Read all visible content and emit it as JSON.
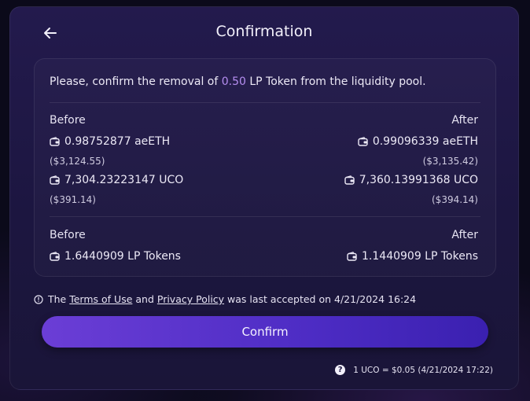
{
  "header": {
    "title": "Confirmation"
  },
  "message": {
    "prefix": "Please, confirm the removal of ",
    "amount": "0.50",
    "suffix": " LP Token from the liquidity pool."
  },
  "section1": {
    "before_label": "Before",
    "after_label": "After",
    "before": {
      "token1": "0.98752877 aeETH",
      "token1_usd": "($3,124.55)",
      "token2": "7,304.23223147 UCO",
      "token2_usd": "($391.14)"
    },
    "after": {
      "token1": "0.99096339 aeETH",
      "token1_usd": "($3,135.42)",
      "token2": "7,360.13991368 UCO",
      "token2_usd": "($394.14)"
    }
  },
  "section2": {
    "before_label": "Before",
    "after_label": "After",
    "before_value": "1.6440909 LP Tokens",
    "after_value": "1.1440909 LP Tokens"
  },
  "terms": {
    "prefix": "The ",
    "terms_link": "Terms of Use",
    "and": " and ",
    "privacy_link": "Privacy Policy",
    "suffix": " was last accepted on 4/21/2024 16:24"
  },
  "confirm_label": "Confirm",
  "rate": "1 UCO = $0.05 (4/21/2024 17:22)",
  "icons": {
    "back": "arrow-left-icon",
    "wallet": "wallet-icon",
    "info": "info-icon",
    "help": "question-icon"
  },
  "colors": {
    "accent": "#b58ef0",
    "button_start": "#6b3ed6",
    "button_end": "#3a20b0",
    "card": "#1c1640"
  }
}
